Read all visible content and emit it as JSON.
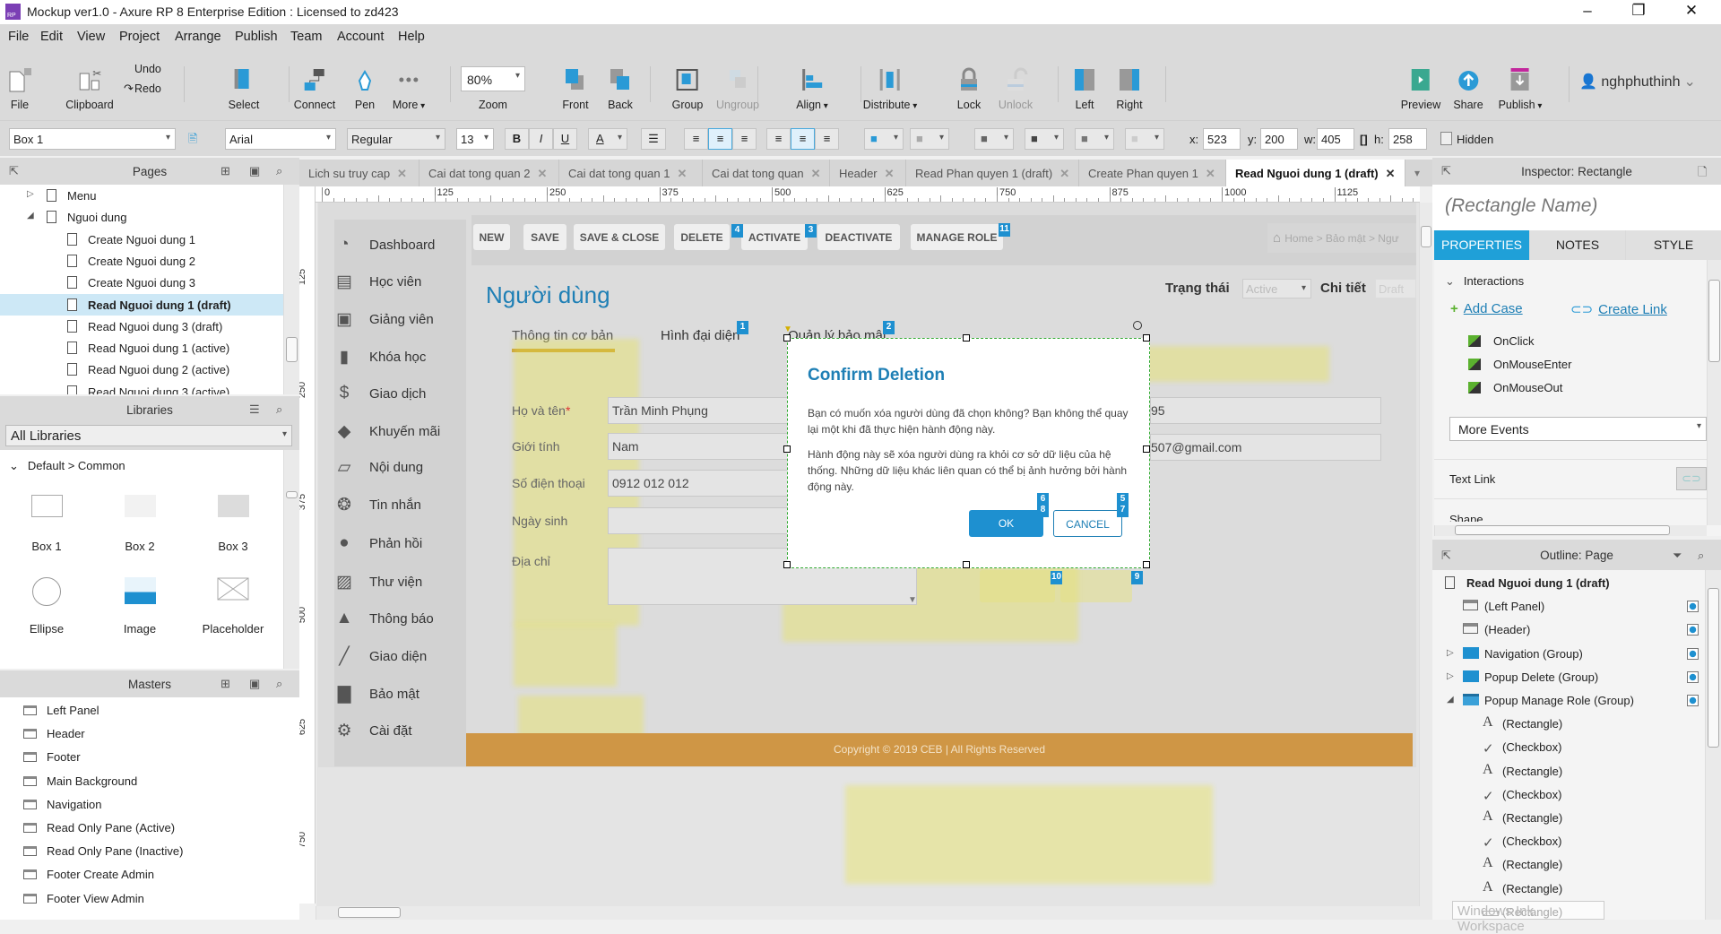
{
  "window": {
    "title": "Mockup ver1.0 - Axure RP 8 Enterprise Edition : Licensed to zd423",
    "logo": "RP",
    "controls": [
      "–",
      "❐",
      "✕"
    ]
  },
  "menu": [
    "File",
    "Edit",
    "View",
    "Project",
    "Arrange",
    "Publish",
    "Team",
    "Account",
    "Help"
  ],
  "toolbar": {
    "items": [
      {
        "label": "File",
        "icon": "file-icon"
      },
      {
        "label": "Clipboard",
        "icon": "clipboard-icon"
      },
      {
        "label": "Select",
        "icon": "select-icon"
      },
      {
        "label": "Connect",
        "icon": "connect-icon"
      },
      {
        "label": "Pen",
        "icon": "pen-icon"
      },
      {
        "label": "More",
        "icon": "more-icon",
        "dropdown": true
      },
      {
        "label": "Zoom",
        "icon": "zoom-select"
      },
      {
        "label": "Front",
        "icon": "front-icon"
      },
      {
        "label": "Back",
        "icon": "back-icon"
      },
      {
        "label": "Group",
        "icon": "group-icon"
      },
      {
        "label": "Ungroup",
        "icon": "ungroup-icon",
        "disabled": true
      },
      {
        "label": "Align",
        "icon": "align-icon",
        "dropdown": true
      },
      {
        "label": "Distribute",
        "icon": "distribute-icon",
        "dropdown": true
      },
      {
        "label": "Lock",
        "icon": "lock-icon"
      },
      {
        "label": "Unlock",
        "icon": "unlock-icon",
        "disabled": true
      },
      {
        "label": "Left",
        "icon": "left-panel-icon"
      },
      {
        "label": "Right",
        "icon": "right-panel-icon"
      },
      {
        "label": "Preview",
        "icon": "preview-icon"
      },
      {
        "label": "Share",
        "icon": "share-icon"
      },
      {
        "label": "Publish",
        "icon": "publish-icon",
        "dropdown": true
      }
    ],
    "undo": "Undo",
    "redo": "Redo",
    "zoom": "80%",
    "user": "nghphuthinh"
  },
  "format": {
    "widget": "Box 1",
    "font": "Arial",
    "weight": "Regular",
    "size": "13",
    "bold": "B",
    "italic": "I",
    "underline": "U",
    "font_color": "A",
    "x_label": "x:",
    "x": "523",
    "y_label": "y:",
    "y": "200",
    "w_label": "w:",
    "w": "405",
    "h_label": "h:",
    "h": "258",
    "hidden": "Hidden"
  },
  "pages": {
    "title": "Pages",
    "items": [
      {
        "label": "Menu",
        "level": 1,
        "expander": "▷"
      },
      {
        "label": "Nguoi dung",
        "level": 1,
        "expander": "◢"
      },
      {
        "label": "Create Nguoi dung 1",
        "level": 2
      },
      {
        "label": "Create Nguoi dung 2",
        "level": 2
      },
      {
        "label": "Create Nguoi dung 3",
        "level": 2
      },
      {
        "label": "Read Nguoi dung 1 (draft)",
        "level": 2,
        "selected": true
      },
      {
        "label": "Read Nguoi dung 3 (draft)",
        "level": 2
      },
      {
        "label": "Read Nguoi dung 1 (active)",
        "level": 2
      },
      {
        "label": "Read Nguoi dung 2 (active)",
        "level": 2
      },
      {
        "label": "Read Nguoi dung 3 (active)",
        "level": 2
      }
    ]
  },
  "libraries": {
    "title": "Libraries",
    "selected": "All Libraries",
    "group": "Default > Common",
    "items": [
      {
        "label": "Box 1",
        "icon": "box1-icon"
      },
      {
        "label": "Box 2",
        "icon": "box2-icon"
      },
      {
        "label": "Box 3",
        "icon": "box3-icon"
      },
      {
        "label": "Ellipse",
        "icon": "ellipse-icon"
      },
      {
        "label": "Image",
        "icon": "image-icon"
      },
      {
        "label": "Placeholder",
        "icon": "placeholder-icon"
      }
    ]
  },
  "masters": {
    "title": "Masters",
    "items": [
      "Left Panel",
      "Header",
      "Footer",
      "Main Background",
      "Navigation",
      "Read Only Pane (Active)",
      "Read Only Pane (Inactive)",
      "Footer Create Admin",
      "Footer View Admin"
    ]
  },
  "tabs": [
    {
      "label": "Lich su truy cap"
    },
    {
      "label": "Cai dat tong quan 2"
    },
    {
      "label": "Cai dat tong quan 1"
    },
    {
      "label": "Cai dat tong quan"
    },
    {
      "label": "Header"
    },
    {
      "label": "Read Phan quyen 1 (draft)"
    },
    {
      "label": "Create Phan quyen 1"
    },
    {
      "label": "Read Nguoi dung 1 (draft)",
      "active": true
    }
  ],
  "ruler": {
    "h": [
      "0",
      "125",
      "250",
      "375",
      "500",
      "625",
      "750",
      "875",
      "1000",
      "1125"
    ],
    "v": [
      "125",
      "250",
      "375",
      "500",
      "625",
      "750"
    ]
  },
  "mockup": {
    "nav": [
      {
        "label": "Dashboard",
        "icon": "dashboard-icon"
      },
      {
        "label": "Học viên",
        "icon": "student-card-icon"
      },
      {
        "label": "Giảng viên",
        "icon": "teacher-icon"
      },
      {
        "label": "Khóa học",
        "icon": "book-icon"
      },
      {
        "label": "Giao dịch",
        "icon": "dollar-icon"
      },
      {
        "label": "Khuyến mãi",
        "icon": "tag-icon"
      },
      {
        "label": "Nội dung",
        "icon": "folder-icon"
      },
      {
        "label": "Tin nhắn",
        "icon": "chat-icon"
      },
      {
        "label": "Phản hồi",
        "icon": "comment-icon"
      },
      {
        "label": "Thư viện",
        "icon": "image-icon"
      },
      {
        "label": "Thông báo",
        "icon": "bell-icon"
      },
      {
        "label": "Giao diện",
        "icon": "brush-icon"
      },
      {
        "label": "Bảo mật",
        "icon": "lock-icon"
      },
      {
        "label": "Cài đặt",
        "icon": "gears-icon"
      }
    ],
    "actions": [
      "NEW",
      "SAVE",
      "SAVE & CLOSE",
      "DELETE",
      "ACTIVATE",
      "DEACTIVATE",
      "MANAGE ROLE"
    ],
    "breadcrumb": "Home > Bảo mật > Ngư",
    "page_title": "Người dùng",
    "status_label": "Trạng thái",
    "status_value": "Active",
    "detail_label": "Chi tiết",
    "detail_value": "Draft",
    "form_tabs": [
      "Thông tin cơ bản",
      "Hình đại diện",
      "Quản lý bảo mật"
    ],
    "fields": [
      {
        "label": "Họ và tên",
        "required": "*",
        "value": "Trần Minh Phụng"
      },
      {
        "label": "Giới tính",
        "value": "Nam"
      },
      {
        "label": "Số điện thoại",
        "value": "0912 012 012"
      },
      {
        "label": "Ngày sinh",
        "value": ""
      },
      {
        "label": "Địa chỉ",
        "value": ""
      }
    ],
    "right_values": [
      "95",
      "507@gmail.com"
    ],
    "footer": "Copyright © 2019 CEB | All Rights Reserved",
    "badges": [
      "4",
      "3",
      "11",
      "1",
      "2",
      "6",
      "8",
      "5",
      "7",
      "10",
      "9"
    ]
  },
  "modal": {
    "title": "Confirm Deletion",
    "p1": "Bạn có muốn xóa người dùng đã chọn không? Bạn không thể quay lại một khi đã thực hiện hành động này.",
    "p2": "Hành động này sẽ xóa người dùng ra khỏi cơ sở dữ liệu của hệ thống. Những dữ liệu khác liên quan có thể bị ảnh hưởng bởi hành động này.",
    "ok": "OK",
    "cancel": "CANCEL"
  },
  "inspector": {
    "title": "Inspector: Rectangle",
    "name": "(Rectangle Name)",
    "tabs": [
      "PROPERTIES",
      "NOTES",
      "STYLE"
    ],
    "interactions": "Interactions",
    "add_case": "Add Case",
    "create_link": "Create Link",
    "events": [
      "OnClick",
      "OnMouseEnter",
      "OnMouseOut"
    ],
    "more_events": "More Events",
    "text_link": "Text Link",
    "shape": "Shape"
  },
  "outline": {
    "title": "Outline: Page",
    "items": [
      {
        "label": "Read Nguoi dung 1 (draft)",
        "icon": "page-icon",
        "level": 0,
        "bold": true
      },
      {
        "label": "(Left Panel)",
        "icon": "master-icon",
        "level": 1,
        "check": true
      },
      {
        "label": "(Header)",
        "icon": "master-icon",
        "level": 1,
        "check": true
      },
      {
        "label": "Navigation (Group)",
        "icon": "folder-icon",
        "level": 1,
        "expander": "▷",
        "check": true
      },
      {
        "label": "Popup Delete (Group)",
        "icon": "folder-icon",
        "level": 1,
        "expander": "▷",
        "check": true
      },
      {
        "label": "Popup Manage Role (Group)",
        "icon": "folder-open-icon",
        "level": 1,
        "expander": "◢",
        "check": true
      },
      {
        "label": "(Rectangle)",
        "icon": "text-icon",
        "level": 2
      },
      {
        "label": "(Checkbox)",
        "icon": "check-icon",
        "level": 2
      },
      {
        "label": "(Rectangle)",
        "icon": "text-icon",
        "level": 2
      },
      {
        "label": "(Checkbox)",
        "icon": "check-icon",
        "level": 2
      },
      {
        "label": "(Rectangle)",
        "icon": "text-icon",
        "level": 2
      },
      {
        "label": "(Checkbox)",
        "icon": "check-icon",
        "level": 2
      },
      {
        "label": "(Rectangle)",
        "icon": "text-icon",
        "level": 2
      },
      {
        "label": "(Rectangle)",
        "icon": "text-icon",
        "level": 2
      },
      {
        "label": "(Rectangle)",
        "icon": "line-icon",
        "level": 2
      }
    ],
    "tooltip": "Windows Ink Workspace"
  },
  "colors": {
    "accent": "#1fa0d8",
    "mockup_title": "#1e7fb5",
    "footer": "#cf9645",
    "tab_underline": "#c9a13f",
    "highlight": "#ebe63c"
  }
}
